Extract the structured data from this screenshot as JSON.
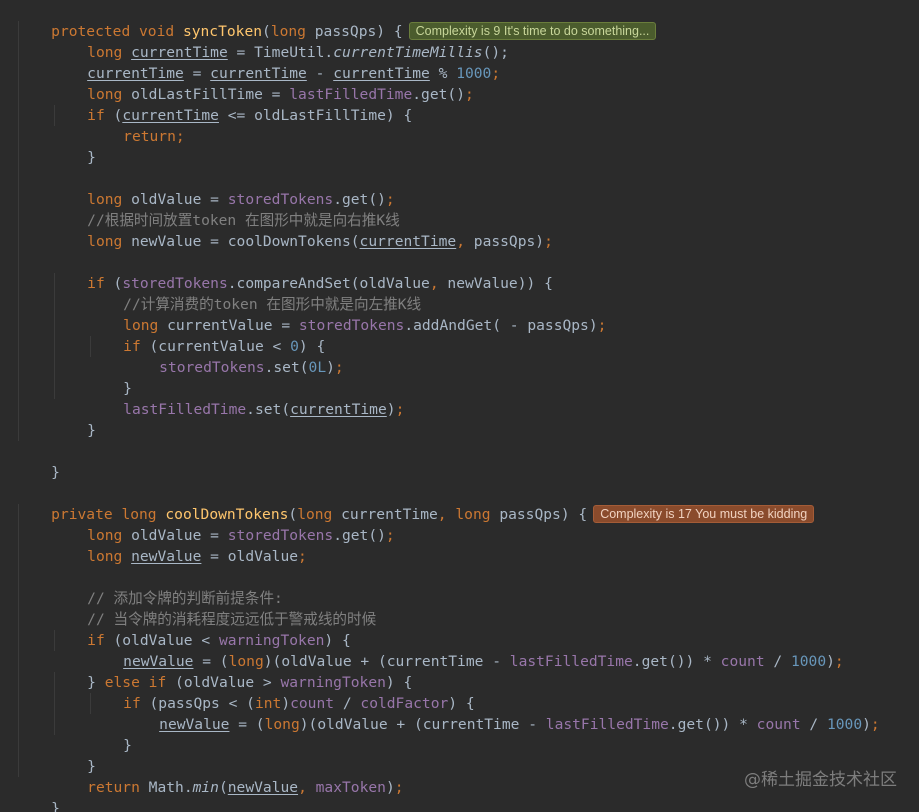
{
  "editor": {
    "badges": {
      "syncToken": "Complexity is 9 It's time to do something...",
      "coolDownTokens": "Complexity is 17 You must be kidding"
    },
    "comments": {
      "c1": "//根据时间放置token 在图形中就是向右推K线",
      "c2": "//计算消费的token 在图形中就是向左推K线",
      "c3": "// 添加令牌的判断前提条件:",
      "c4": "// 当令牌的消耗程度远远低于警戒线的时候"
    },
    "colors": {
      "background": "#2b2b2b",
      "keyword": "#cc7832",
      "function": "#ffc66d",
      "field": "#9876aa",
      "number": "#6897bb",
      "comment": "#808080",
      "text": "#a9b7c6"
    }
  },
  "watermark": "@稀土掘金技术社区"
}
